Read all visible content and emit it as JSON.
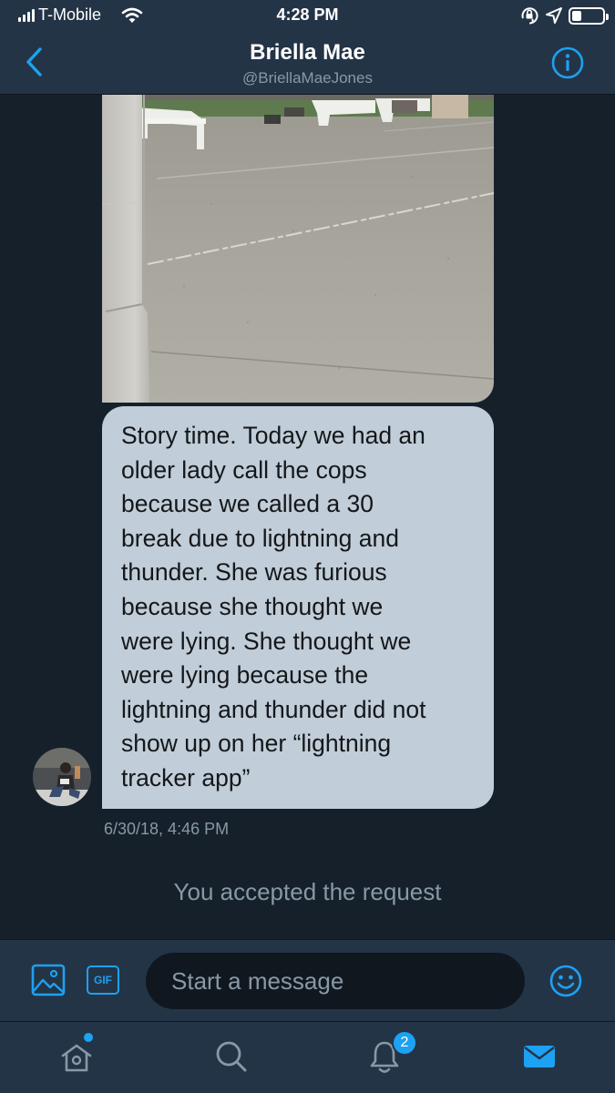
{
  "status_bar": {
    "carrier": "T-Mobile",
    "time": "4:28 PM"
  },
  "header": {
    "name": "Briella Mae",
    "handle": "@BriellaMaeJones"
  },
  "conversation": {
    "message_text": "Story time. Today we had an\nolder lady call the cops\nbecause we called a 30\nbreak due to lightning and\nthunder. She was furious\nbecause she thought we\nwere lying. She thought we\nwere lying because the\nlightning and thunder did not\nshow up on her “lightning\ntracker app”",
    "timestamp": "6/30/18, 4:46 PM",
    "system_note": "You accepted the request"
  },
  "composer": {
    "gif_label": "GIF",
    "placeholder": "Start a message"
  },
  "tabbar": {
    "notification_count": "2"
  },
  "colors": {
    "background": "#15202b",
    "bar": "#243447",
    "accent": "#1da1f2",
    "bubble": "#c1cdd8",
    "secondary_text": "#8899a6"
  },
  "icons": [
    "signal-icon",
    "wifi-icon",
    "orientation-lock-icon",
    "location-icon",
    "battery-icon",
    "back-chevron-icon",
    "info-icon",
    "image-icon",
    "emoji-icon",
    "home-icon",
    "search-icon",
    "bell-icon",
    "mail-icon"
  ]
}
